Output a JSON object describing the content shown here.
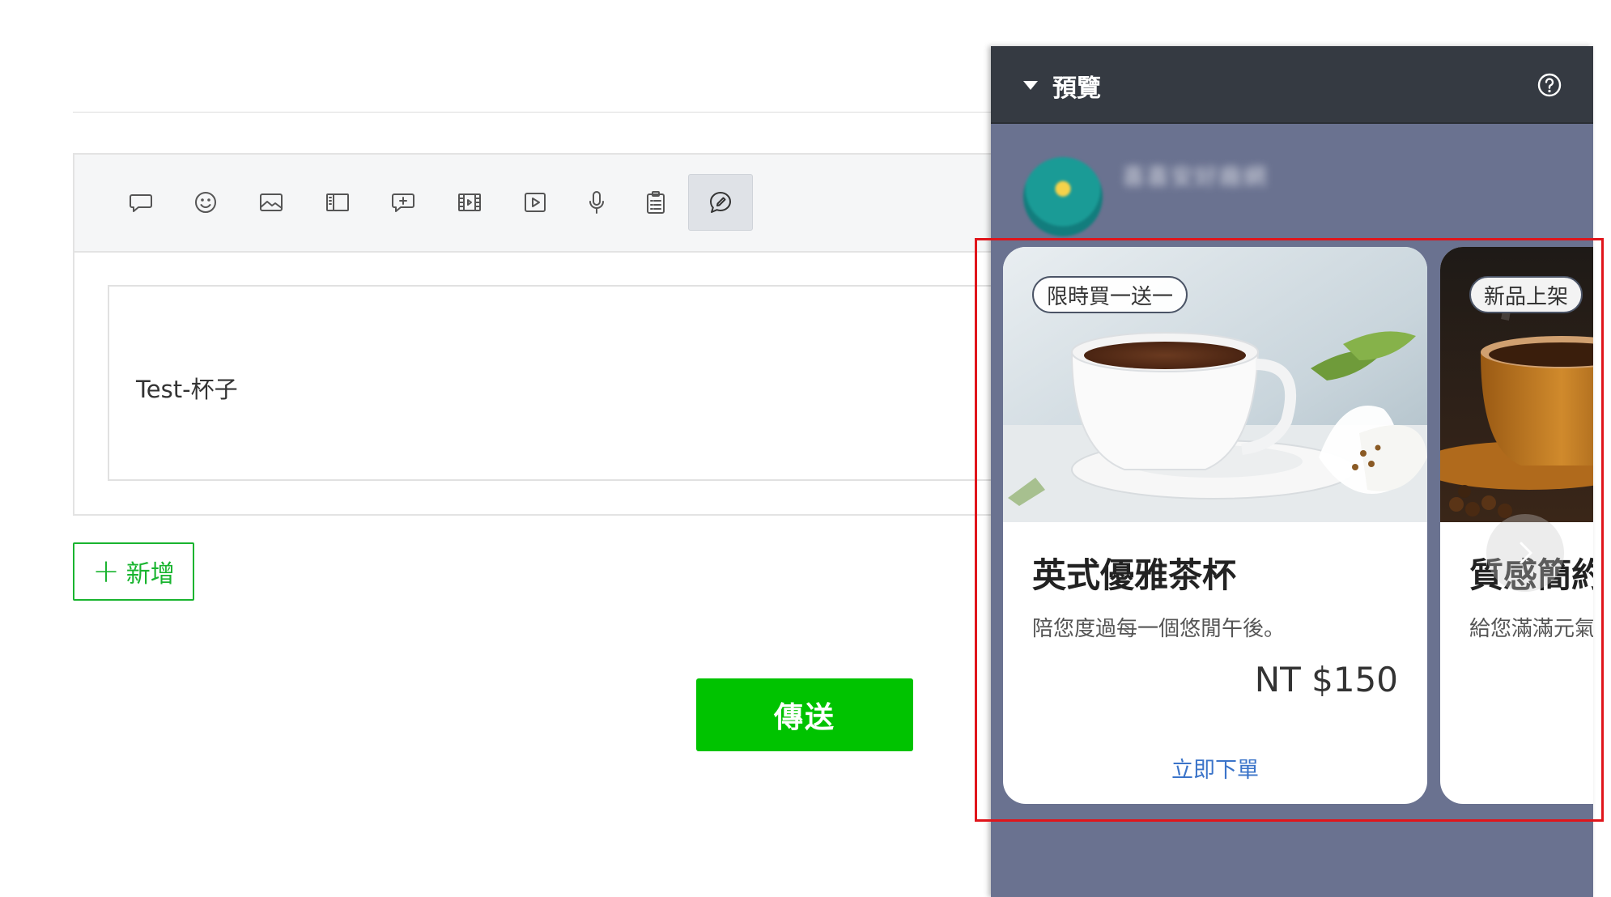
{
  "toolbar": {
    "tools": [
      {
        "name": "text-message",
        "icon": "speech-bubble-icon"
      },
      {
        "name": "sticker",
        "icon": "smiley-icon"
      },
      {
        "name": "image",
        "icon": "image-icon"
      },
      {
        "name": "card-message",
        "icon": "panel-icon"
      },
      {
        "name": "rich-message",
        "icon": "bubble-plus-icon"
      },
      {
        "name": "rich-video",
        "icon": "film-icon"
      },
      {
        "name": "video",
        "icon": "play-icon"
      },
      {
        "name": "audio",
        "icon": "microphone-icon"
      },
      {
        "name": "survey",
        "icon": "clipboard-icon"
      },
      {
        "name": "flex-message",
        "icon": "bubble-edit-icon",
        "active": true
      }
    ]
  },
  "editor": {
    "message_text": "Test-杯子"
  },
  "actions": {
    "add_label": "新增",
    "send_label": "傳送"
  },
  "preview": {
    "title": "預覽",
    "sender_name": "喜喜安好廠網",
    "cards": [
      {
        "badge": "限時買一送一",
        "title": "英式優雅茶杯",
        "description": "陪您度過每一個悠閒午後。",
        "price": "NT $150",
        "action": "立即下單"
      },
      {
        "badge": "新品上架",
        "title": "質感簡約",
        "description": "給您滿滿元氣",
        "price": "",
        "action": ""
      }
    ]
  },
  "colors": {
    "accent_green": "#00c300",
    "outline_green": "#19b42f",
    "preview_header": "#353a42",
    "preview_background": "#6a7290",
    "link_blue": "#3b74c9",
    "highlight_red": "#e0151b"
  }
}
